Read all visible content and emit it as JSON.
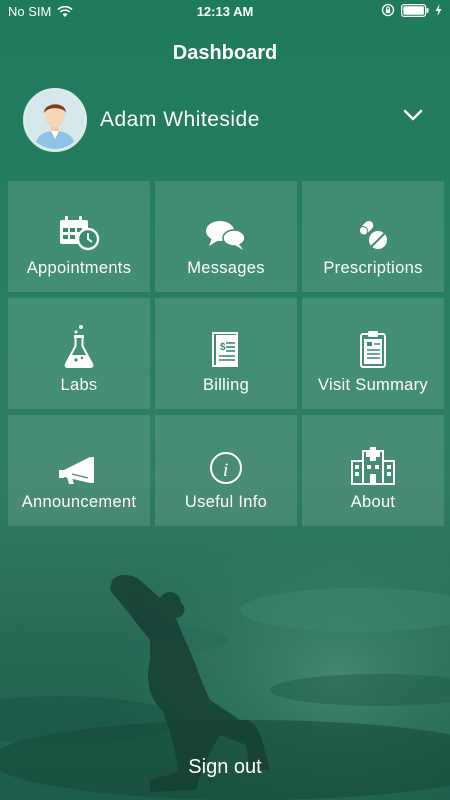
{
  "status_bar": {
    "carrier": "No SIM",
    "time": "12:13 AM",
    "icons": [
      "wifi-icon",
      "orientation-lock-icon",
      "battery-icon",
      "charging-icon"
    ]
  },
  "header": {
    "title": "Dashboard"
  },
  "profile": {
    "name": "Adam Whiteside",
    "avatar_icon": "user-avatar",
    "dropdown_icon": "chevron-down-icon"
  },
  "tiles": [
    {
      "label": "Appointments",
      "icon": "calendar-clock-icon"
    },
    {
      "label": "Messages",
      "icon": "chat-bubbles-icon"
    },
    {
      "label": "Prescriptions",
      "icon": "pills-icon"
    },
    {
      "label": "Labs",
      "icon": "flask-icon"
    },
    {
      "label": "Billing",
      "icon": "bill-icon"
    },
    {
      "label": "Visit Summary",
      "icon": "clipboard-icon"
    },
    {
      "label": "Announcement",
      "icon": "megaphone-icon"
    },
    {
      "label": "Useful Info",
      "icon": "info-icon"
    },
    {
      "label": "About",
      "icon": "hospital-icon"
    }
  ],
  "footer": {
    "signout_label": "Sign out"
  },
  "colors": {
    "background_top": "#1f7a5e",
    "background_bottom": "#1e5d4b",
    "tile_overlay": "rgba(255,255,255,0.12)",
    "text": "#ffffff"
  }
}
